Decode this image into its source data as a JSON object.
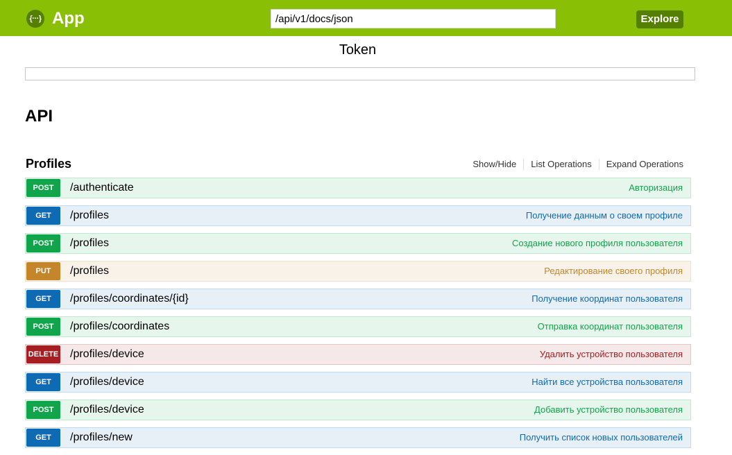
{
  "header": {
    "logo_glyph": "{···}",
    "app_title": "App",
    "url_value": "/api/v1/docs/json",
    "explore_label": "Explore",
    "colors": {
      "bar": "#89bf04",
      "button": "#547f00"
    }
  },
  "token": {
    "label": "Token",
    "value": ""
  },
  "api_title": "API",
  "section": {
    "title": "Profiles",
    "show_hide": "Show/Hide",
    "list_operations": "List Operations",
    "expand_operations": "Expand Operations"
  },
  "operations": [
    {
      "method": "POST",
      "path": "/authenticate",
      "summary": "Авторизация"
    },
    {
      "method": "GET",
      "path": "/profiles",
      "summary": "Получение данным о своем профиле"
    },
    {
      "method": "POST",
      "path": "/profiles",
      "summary": "Создание нового профиля пользователя"
    },
    {
      "method": "PUT",
      "path": "/profiles",
      "summary": "Редактирование своего профиля"
    },
    {
      "method": "GET",
      "path": "/profiles/coordinates/{id}",
      "summary": "Получение координат пользователя"
    },
    {
      "method": "POST",
      "path": "/profiles/coordinates",
      "summary": "Отправка координат пользователя"
    },
    {
      "method": "DELETE",
      "path": "/profiles/device",
      "summary": "Удалить устройство пользователя"
    },
    {
      "method": "GET",
      "path": "/profiles/device",
      "summary": "Найти все устройства пользователя"
    },
    {
      "method": "POST",
      "path": "/profiles/device",
      "summary": "Добавить устройство пользователя"
    },
    {
      "method": "GET",
      "path": "/profiles/new",
      "summary": "Получить список новых пользователей"
    }
  ],
  "method_colors": {
    "POST": "#10a54a",
    "GET": "#0f6ab4",
    "PUT": "#c5862b",
    "DELETE": "#a41e22"
  }
}
